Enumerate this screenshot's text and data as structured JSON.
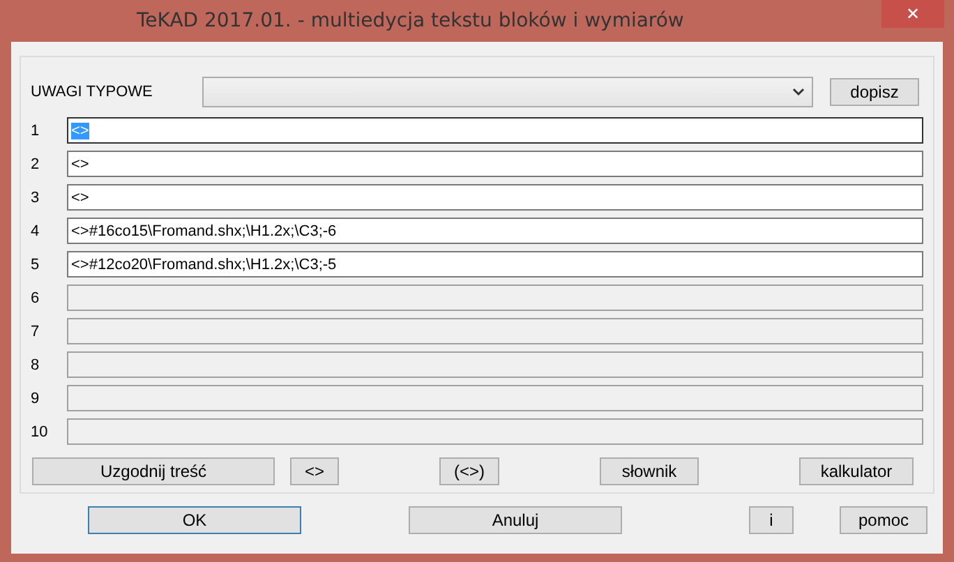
{
  "window": {
    "title": "TeKAD 2017.01. - multiedycja tekstu bloków i wymiarów",
    "close": "✕"
  },
  "uwagi": {
    "label": "UWAGI TYPOWE",
    "button": "dopisz"
  },
  "lines": [
    {
      "number": "1",
      "value": "<>",
      "disabled": false,
      "highlighted": true
    },
    {
      "number": "2",
      "value": "<>",
      "disabled": false,
      "highlighted": false
    },
    {
      "number": "3",
      "value": "<>",
      "disabled": false,
      "highlighted": false
    },
    {
      "number": "4",
      "value": "<>#16co15\\Fromand.shx;\\H1.2x;\\C3;-6",
      "disabled": false,
      "highlighted": false
    },
    {
      "number": "5",
      "value": "<>#12co20\\Fromand.shx;\\H1.2x;\\C3;-5",
      "disabled": false,
      "highlighted": false
    },
    {
      "number": "6",
      "disabled": true,
      "highlighted": false
    },
    {
      "number": "7",
      "disabled": true,
      "highlighted": false
    },
    {
      "number": "8",
      "disabled": true,
      "highlighted": false
    },
    {
      "number": "9",
      "disabled": true,
      "highlighted": false
    },
    {
      "number": "10",
      "disabled": true,
      "highlighted": false
    }
  ],
  "tools": [
    "Uzgodnij treść",
    "<>",
    "(<>)",
    "słownik",
    "kalkulator"
  ],
  "buttons": [
    {
      "label": "OK",
      "default": true
    },
    {
      "label": "Anuluj",
      "default": false
    },
    {
      "label": "i",
      "default": false
    },
    {
      "label": "pomoc",
      "default": false
    }
  ]
}
